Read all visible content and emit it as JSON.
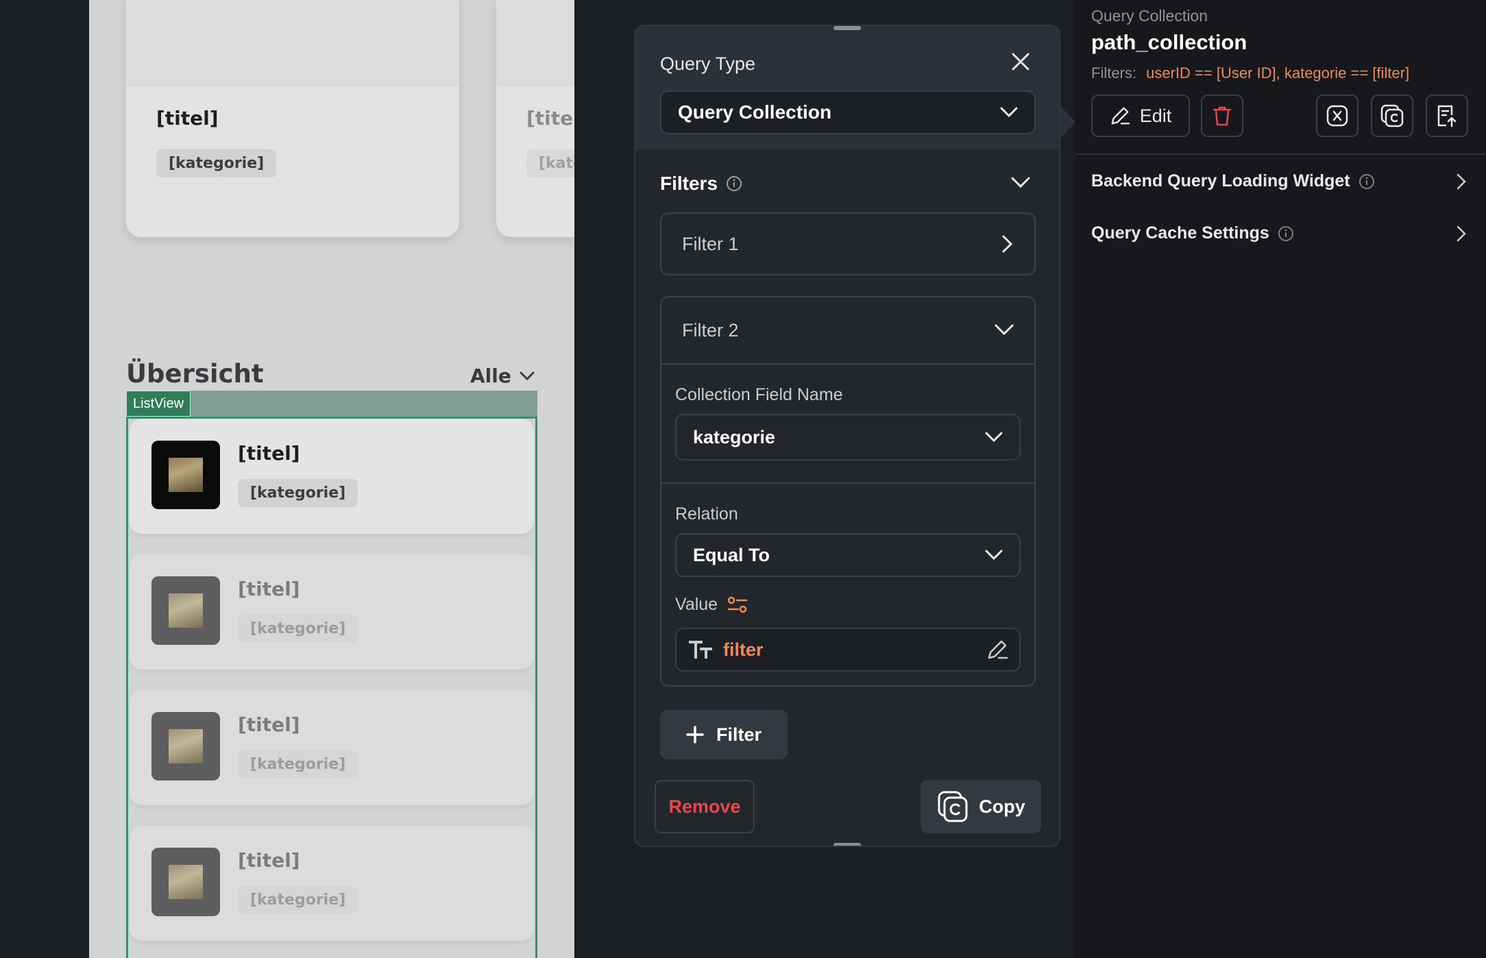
{
  "canvas": {
    "top_cards": [
      {
        "title": "[titel]",
        "category": "[kategorie]"
      },
      {
        "title": "[titel",
        "category": "[kate"
      }
    ],
    "section_title": "Übersicht",
    "section_filter": "Alle",
    "listview_tag": "ListView",
    "list_items": [
      {
        "title": "[titel]",
        "category": "[kategorie]"
      },
      {
        "title": "[titel]",
        "category": "[kategorie]"
      },
      {
        "title": "[titel]",
        "category": "[kategorie]"
      },
      {
        "title": "[titel]",
        "category": "[kategorie]"
      }
    ]
  },
  "query_panel": {
    "query_type_label": "Query Type",
    "query_type_value": "Query Collection",
    "filters_label": "Filters",
    "filter1_label": "Filter 1",
    "filter2_label": "Filter 2",
    "collection_field_label": "Collection Field Name",
    "collection_field_value": "kategorie",
    "relation_label": "Relation",
    "relation_value": "Equal To",
    "value_label": "Value",
    "value_text": "filter",
    "add_filter_label": "Filter",
    "remove_label": "Remove",
    "copy_label": "Copy"
  },
  "properties": {
    "header_label": "Query Collection",
    "collection_name": "path_collection",
    "filters_prefix": "Filters:",
    "filters_value": "userID == [User ID], kategorie == [filter]",
    "edit_label": "Edit",
    "rows": [
      {
        "label": "Backend Query Loading Widget"
      },
      {
        "label": "Query Cache Settings"
      }
    ]
  },
  "colors": {
    "accent_orange": "#ee8a5b",
    "danger_red": "#e5484d",
    "listview_green": "#2f7d5b",
    "panel_bg": "#23272c"
  }
}
